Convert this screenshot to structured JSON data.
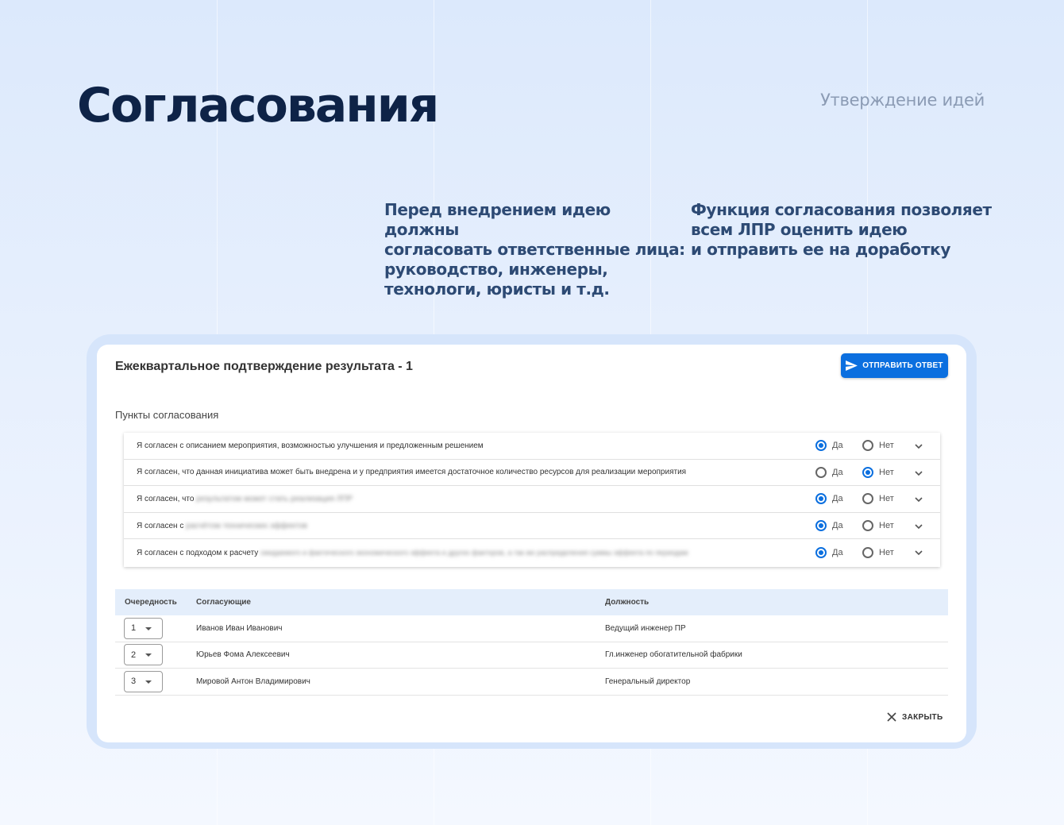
{
  "page": {
    "title": "Согласования",
    "section": "Утверждение идей",
    "intro_left": [
      "Перед внедрением идею должны",
      "согласовать ответственные лица:",
      "руководство, инженеры,",
      "технологи, юристы и т.д."
    ],
    "intro_right": [
      "Функция согласования позволяет",
      "всем ЛПР оценить идею",
      "и отправить ее на доработку"
    ]
  },
  "dialog": {
    "title": "Ежеквартальное подтверждение результата - 1",
    "send_button": "ОТПРАВИТЬ ОТВЕТ",
    "items_label": "Пункты согласования",
    "yes_label": "Да",
    "no_label": "Нет",
    "items": [
      {
        "text": "Я согласен с описанием мероприятия, возможностью улучшения и предложенным решением",
        "hidden": "",
        "answer": "yes"
      },
      {
        "text": "Я согласен, что данная инициатива может быть внедрена и у предприятия имеется достаточное количество ресурсов для реализации мероприятия",
        "hidden": "",
        "answer": "no"
      },
      {
        "text": "Я согласен, что ",
        "hidden": "результатом может стать реализация ЛПР",
        "answer": "yes"
      },
      {
        "text": "Я согласен с ",
        "hidden": "расчётом технических эффектов",
        "answer": "yes"
      },
      {
        "text": "Я согласен с подходом к расчету ",
        "hidden": "ожидаемого и фактического экономического эффекта и других факторов, а так же распределения суммы эффекта по периодам",
        "answer": "yes"
      }
    ],
    "table": {
      "headers": [
        "Очередность",
        "Согласующие",
        "Должность"
      ],
      "rows": [
        {
          "order": "1",
          "name": "Иванов Иван Иванович",
          "position": "Ведущий инженер ПР"
        },
        {
          "order": "2",
          "name": "Юрьев Фома Алексеевич",
          "position": "Гл.инженер обогатительной фабрики"
        },
        {
          "order": "3",
          "name": "Мировой Антон Владимирович",
          "position": "Генеральный директор"
        }
      ]
    },
    "close_button": "ЗАКРЫТЬ"
  },
  "colors": {
    "accent": "#0b6fdf",
    "title": "#0e2347",
    "intro": "#2d4a74"
  }
}
